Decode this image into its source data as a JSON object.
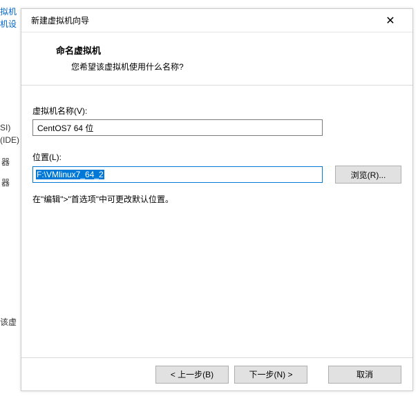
{
  "background": {
    "link1": "拟机",
    "link2": "机设",
    "t1": "SI)",
    "t2": "(IDE)",
    "t3": "器",
    "t4": "器",
    "t5": "该虚"
  },
  "dialog": {
    "title": "新建虚拟机向导",
    "close_icon": "✕"
  },
  "header": {
    "title": "命名虚拟机",
    "subtitle": "您希望该虚拟机使用什么名称?"
  },
  "fields": {
    "name_label": "虚拟机名称(V):",
    "name_value": "CentOS7 64 位",
    "location_label": "位置(L):",
    "location_value": "F:\\VMlinux7_64_2",
    "browse_label": "浏览(R)...",
    "hint": "在\"编辑\">\"首选项\"中可更改默认位置。"
  },
  "footer": {
    "back": "< 上一步(B)",
    "next": "下一步(N) >",
    "cancel": "取消"
  }
}
